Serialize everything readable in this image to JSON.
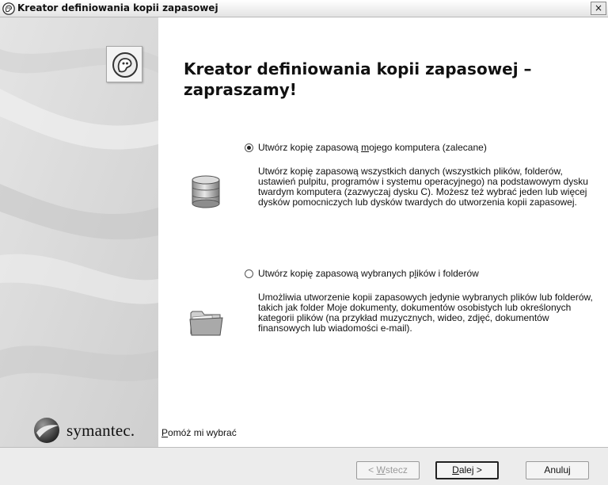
{
  "window": {
    "title": "Kreator definiowania kopii zapasowej",
    "close_glyph": "×"
  },
  "left": {
    "brand_name": "symantec.",
    "product_icon": "norton-ghost-icon",
    "brand_logo": "symantec-logo"
  },
  "main": {
    "heading": "Kreator definiowania kopii zapasowej – zapraszamy!",
    "options": [
      {
        "label_before": "Utwórz kopię zapasową ",
        "label_mnemonic": "m",
        "label_after": "ojego komputera (zalecane)",
        "selected": true,
        "icon": "hard-disk-icon",
        "description": "Utwórz kopię zapasową wszystkich danych (wszystkich plików, folderów, ustawień pulpitu, programów i systemu operacyjnego) na podstawowym dysku twardym komputera (zazwyczaj dysku C). Możesz też wybrać jeden lub więcej dysków pomocniczych lub dysków twardych do utworzenia kopii zapasowej."
      },
      {
        "label_before": "Utwórz kopię zapasową wybranych p",
        "label_mnemonic": "l",
        "label_after": "ików i folderów",
        "selected": false,
        "icon": "folder-icon",
        "description": "Umożliwia utworzenie kopii zapasowych jedynie wybranych plików lub folderów, takich jak folder Moje dokumenty, dokumentów osobistych lub określonych kategorii plików (na przykład muzycznych, wideo, zdjęć, dokumentów finansowych lub wiadomości e-mail)."
      }
    ],
    "help_link": {
      "mnemonic": "P",
      "rest": "omóż mi wybrać"
    }
  },
  "buttons": {
    "back": {
      "prefix": "< ",
      "mnemonic": "W",
      "rest": "stecz",
      "enabled": false
    },
    "next": {
      "mnemonic": "D",
      "rest": "alej >",
      "enabled": true,
      "default": true
    },
    "cancel": {
      "label": "Anuluj",
      "enabled": true
    }
  }
}
